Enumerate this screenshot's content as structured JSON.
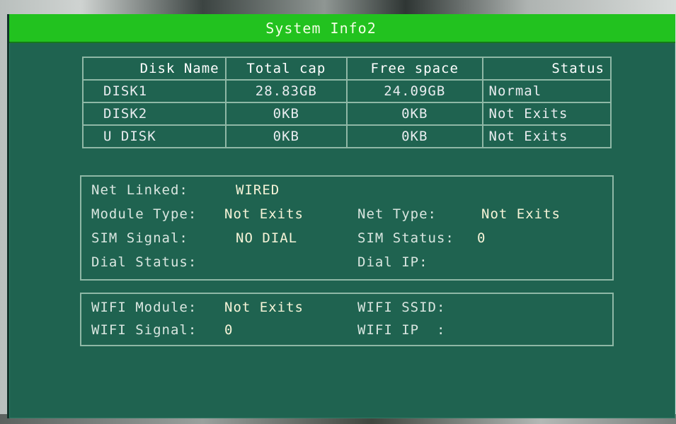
{
  "window": {
    "title": "System Info2"
  },
  "disk_table": {
    "headers": [
      "Disk Name",
      "Total cap",
      "Free space",
      "Status"
    ],
    "rows": [
      {
        "name": "DISK1",
        "total": "28.83GB",
        "free": "24.09GB",
        "status": "Normal"
      },
      {
        "name": "DISK2",
        "total": "0KB",
        "free": "0KB",
        "status": "Not Exits"
      },
      {
        "name": "U DISK",
        "total": "0KB",
        "free": "0KB",
        "status": "Not Exits"
      }
    ]
  },
  "network": {
    "net_linked_label": "Net Linked:",
    "net_linked_value": "WIRED",
    "module_type_label": "Module Type:",
    "module_type_value": "Not Exits",
    "net_type_label": "Net Type:",
    "net_type_value": "Not Exits",
    "sim_signal_label": "SIM Signal:",
    "sim_signal_value": "NO DIAL",
    "sim_status_label": "SIM Status:",
    "sim_status_value": "0",
    "dial_status_label": "Dial Status:",
    "dial_status_value": "",
    "dial_ip_label": "Dial IP:",
    "dial_ip_value": ""
  },
  "wifi": {
    "module_label": "WIFI Module:",
    "module_value": "Not Exits",
    "ssid_label": "WIFI SSID:",
    "ssid_value": "",
    "signal_label": "WIFI Signal:",
    "signal_value": "0",
    "ip_label": "WIFI IP  :",
    "ip_value": ""
  },
  "colors": {
    "title_bar": "#22c21f",
    "window_bg": "#1f6350",
    "border": "#8fb8a6",
    "text": "#e8ecef"
  }
}
